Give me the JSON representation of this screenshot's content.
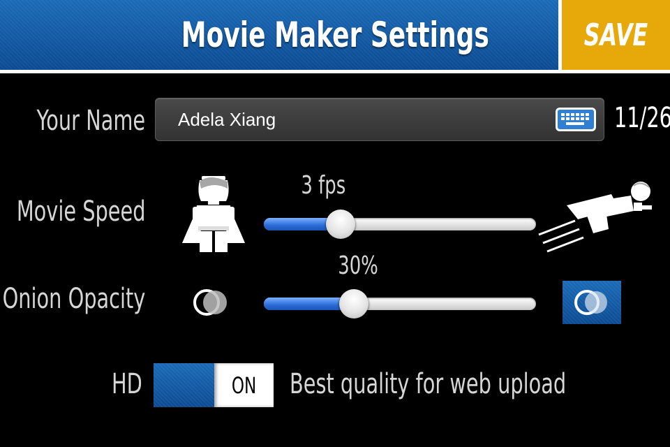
{
  "header": {
    "title": "Movie Maker Settings",
    "save_label": "SAVE"
  },
  "name": {
    "label": "Your Name",
    "value": "Adela Xiang",
    "char_count": "11/26"
  },
  "speed": {
    "label": "Movie Speed",
    "value_text": "3 fps",
    "level": 0.25,
    "slow_icon": "lego-minifig-standing-icon",
    "fast_icon": "lego-minifig-flying-icon"
  },
  "onion": {
    "label": "Onion Opacity",
    "value_text": "30%",
    "level": 0.3,
    "low_icon": "onion-skin-icon",
    "high_icon": "onion-skin-icon"
  },
  "hd": {
    "label": "HD",
    "state_label": "ON",
    "description": "Best quality for web upload"
  },
  "colors": {
    "accent_blue": "#0b4a92",
    "save_yellow": "#e7a90a",
    "slider_fill": "#2a6bd6",
    "background": "#000000"
  }
}
